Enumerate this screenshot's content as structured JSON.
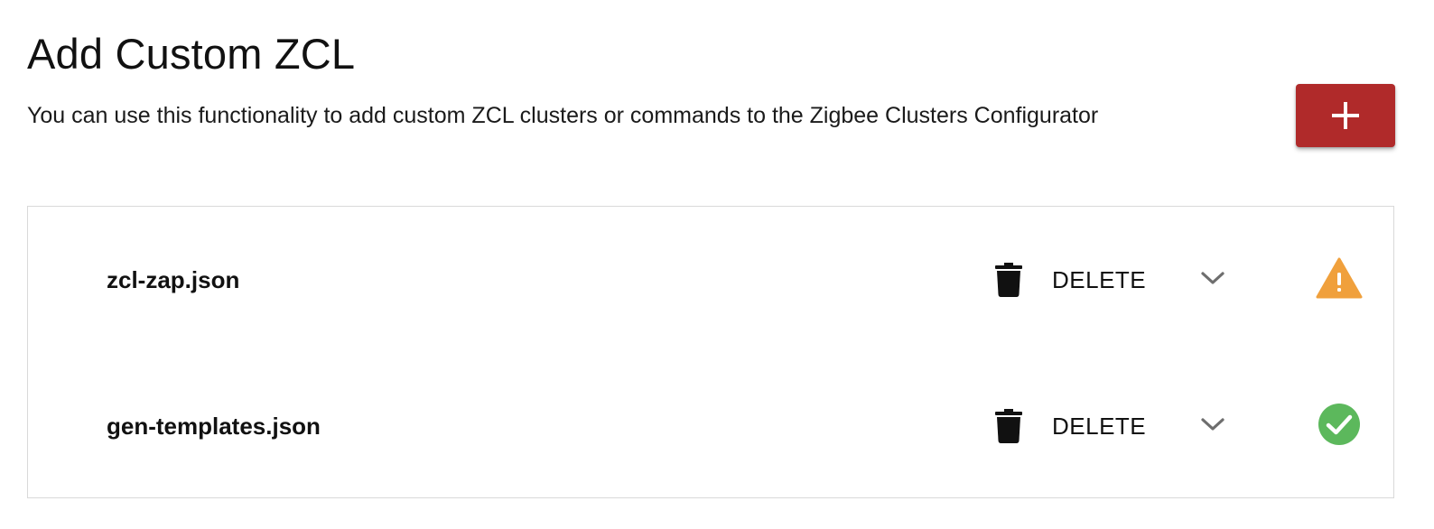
{
  "page": {
    "title": "Add Custom ZCL",
    "description": "You can use this functionality to add custom ZCL clusters or commands to the Zigbee Clusters Configurator"
  },
  "add_button": {
    "icon": "plus-icon",
    "color": "#b02a2a"
  },
  "files": [
    {
      "name": "zcl-zap.json",
      "delete_label": "DELETE",
      "delete_icon": "trash-icon",
      "expand_icon": "chevron-down-icon",
      "status": "warning",
      "status_icon": "warning-icon",
      "status_color": "#f0a03c"
    },
    {
      "name": "gen-templates.json",
      "delete_label": "DELETE",
      "delete_icon": "trash-icon",
      "expand_icon": "chevron-down-icon",
      "status": "ok",
      "status_icon": "check-circle-icon",
      "status_color": "#5cb85c"
    }
  ]
}
